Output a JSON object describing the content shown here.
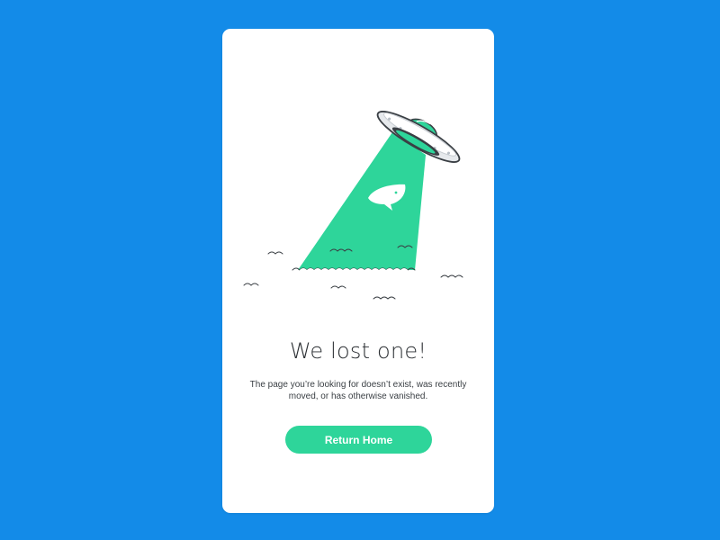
{
  "page": {
    "background_color": "#138be8",
    "card_color": "#ffffff",
    "accent_color": "#2ed59a"
  },
  "illustration": {
    "icons": [
      "ufo-icon",
      "tractor-beam",
      "whale-icon",
      "ocean-waves"
    ]
  },
  "content": {
    "title": "We lost one!",
    "message": "The page you’re looking for doesn’t exist, was recently moved, or has otherwise vanished.",
    "button_label": "Return Home"
  }
}
